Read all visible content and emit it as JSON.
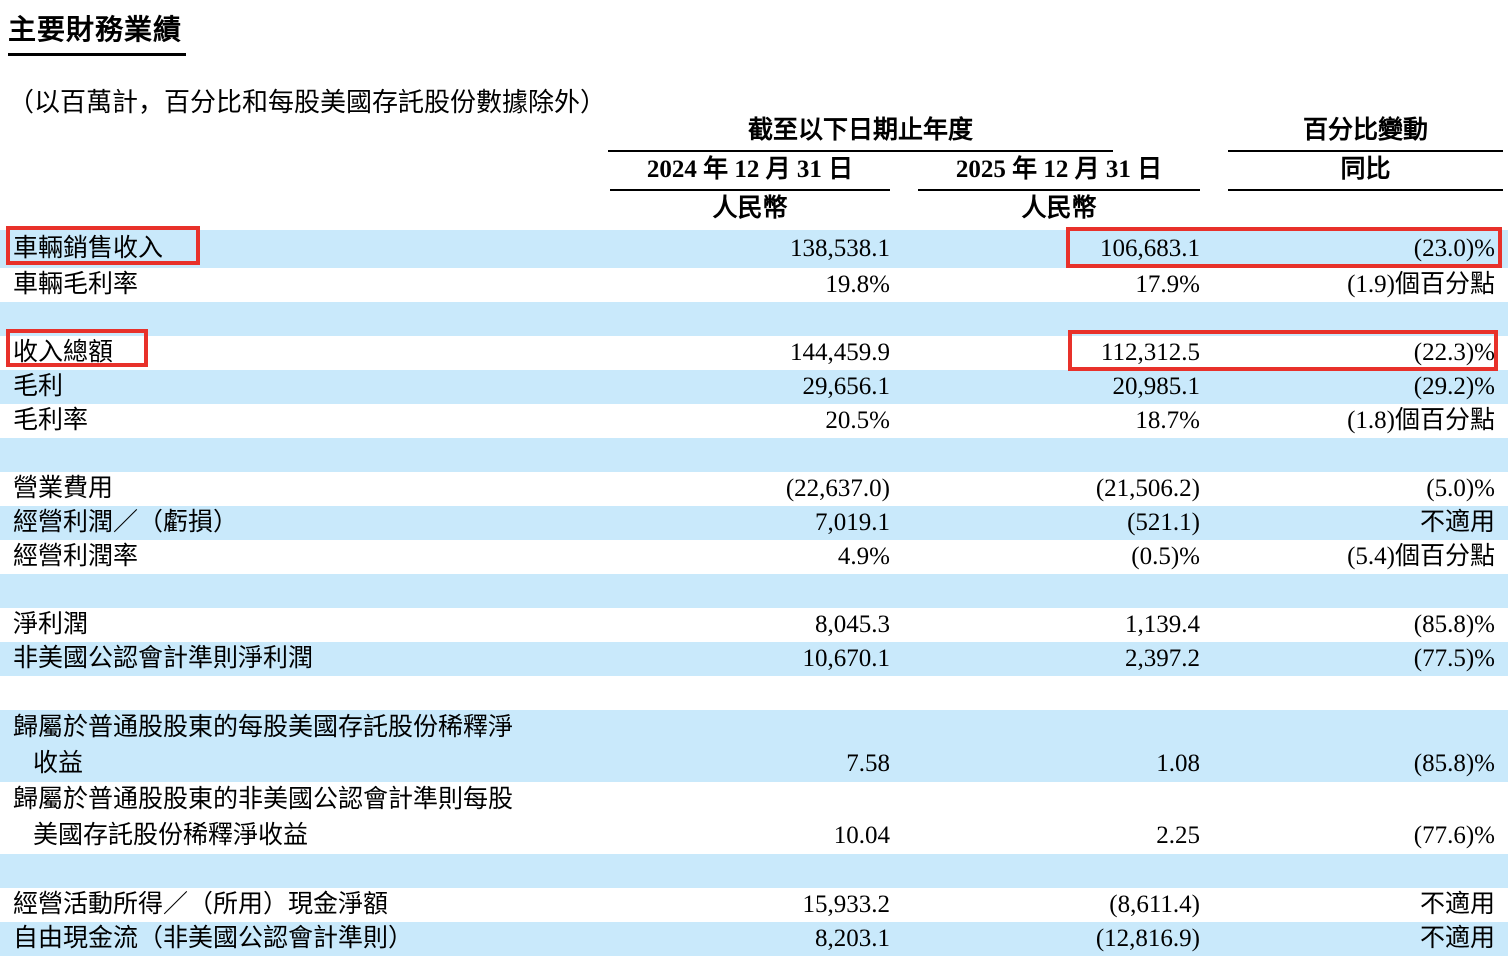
{
  "page": {
    "title": "主要財務業績",
    "subtitle": "（以百萬計，百分比和每股美國存託股份數據除外）"
  },
  "table": {
    "header": {
      "period_group": "截至以下日期止年度",
      "change_group": "百分比變動",
      "date_2024": "2024 年 12 月 31 日",
      "date_2025": "2025 年 12 月 31 日",
      "yoy_label": "同比",
      "currency_2024": "人民幣",
      "currency_2025": "人民幣"
    },
    "rows": [
      {
        "label": "車輛銷售收入",
        "v2024": "138,538.1",
        "v2025": "106,683.1",
        "change": "(23.0)%",
        "band": true,
        "highlight_label": true,
        "highlight_values": true
      },
      {
        "label": "車輛毛利率",
        "v2024": "19.8%",
        "v2025": "17.9%",
        "change": "(1.9)個百分點",
        "band": false
      },
      {
        "label": "",
        "v2024": "",
        "v2025": "",
        "change": "",
        "band": true
      },
      {
        "label": "收入總額",
        "v2024": "144,459.9",
        "v2025": "112,312.5",
        "change": "(22.3)%",
        "band": false,
        "highlight_label": true,
        "highlight_values": true
      },
      {
        "label": "毛利",
        "v2024": "29,656.1",
        "v2025": "20,985.1",
        "change": "(29.2)%",
        "band": true
      },
      {
        "label": "毛利率",
        "v2024": "20.5%",
        "v2025": "18.7%",
        "change": "(1.8)個百分點",
        "band": false
      },
      {
        "label": "",
        "v2024": "",
        "v2025": "",
        "change": "",
        "band": true
      },
      {
        "label": "營業費用",
        "v2024": "(22,637.0)",
        "v2025": "(21,506.2)",
        "change": "(5.0)%",
        "band": false
      },
      {
        "label": "經營利潤／（虧損）",
        "v2024": "7,019.1",
        "v2025": "(521.1)",
        "change": "不適用",
        "band": true
      },
      {
        "label": "經營利潤率",
        "v2024": "4.9%",
        "v2025": "(0.5)%",
        "change": "(5.4)個百分點",
        "band": false
      },
      {
        "label": "",
        "v2024": "",
        "v2025": "",
        "change": "",
        "band": true
      },
      {
        "label": "淨利潤",
        "v2024": "8,045.3",
        "v2025": "1,139.4",
        "change": "(85.8)%",
        "band": false
      },
      {
        "label": "非美國公認會計準則淨利潤",
        "v2024": "10,670.1",
        "v2025": "2,397.2",
        "change": "(77.5)%",
        "band": true
      },
      {
        "label": "",
        "v2024": "",
        "v2025": "",
        "change": "",
        "band": false
      },
      {
        "label": "歸屬於普通股股東的每股美國存託股份稀釋淨",
        "label2": "收益",
        "v2024": "7.58",
        "v2025": "1.08",
        "change": "(85.8)%",
        "band": true
      },
      {
        "label": "歸屬於普通股股東的非美國公認會計準則每股",
        "label2": "美國存託股份稀釋淨收益",
        "v2024": "10.04",
        "v2025": "2.25",
        "change": "(77.6)%",
        "band": false
      },
      {
        "label": "",
        "v2024": "",
        "v2025": "",
        "change": "",
        "band": true
      },
      {
        "label": "經營活動所得／（所用）現金淨額",
        "v2024": "15,933.2",
        "v2025": "(8,611.4)",
        "change": "不適用",
        "band": false
      },
      {
        "label": "自由現金流（非美國公認會計準則）",
        "v2024": "8,203.1",
        "v2025": "(12,816.9)",
        "change": "不適用",
        "band": true
      }
    ]
  },
  "highlights": {
    "color": "#e8312a",
    "boxes": [
      "vehicle-sales-revenue-label",
      "vehicle-sales-revenue-2025-value-and-change",
      "total-revenue-label",
      "total-revenue-2025-value-and-change"
    ]
  },
  "colors": {
    "band_blue": "#c9e9fb",
    "text": "#000000",
    "background": "#ffffff"
  }
}
